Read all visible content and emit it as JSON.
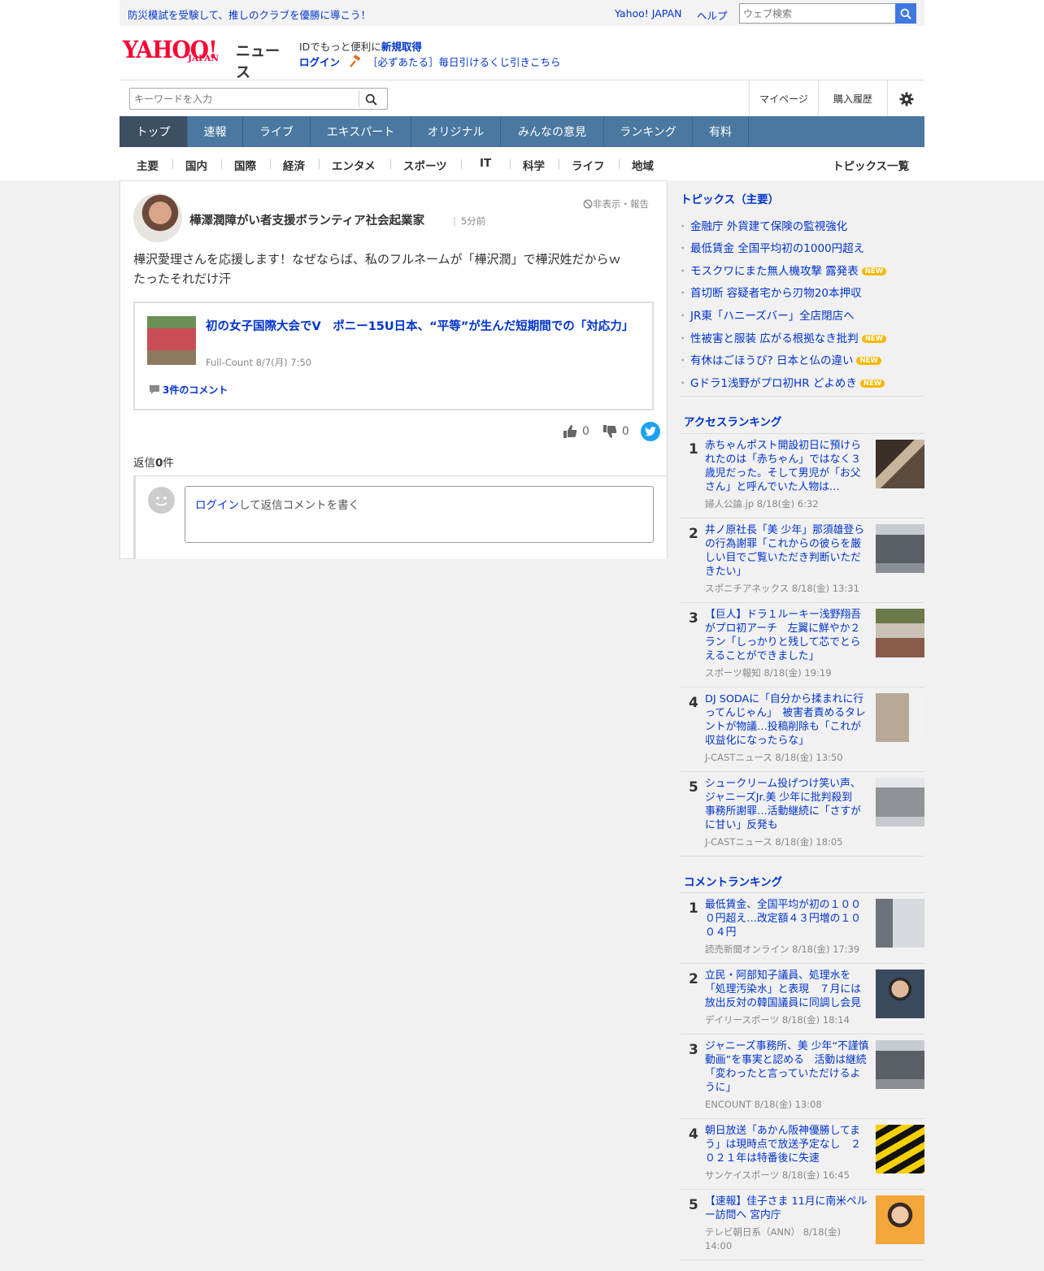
{
  "promo": {
    "text": "防災模試を受験して、推しのクラブを優勝に導こう！"
  },
  "header": {
    "yahoo_japan_link": "Yahoo! JAPAN",
    "help_link": "ヘルプ",
    "web_search_placeholder": "ウェブ検索",
    "logo_yahoo": "YAHOO!",
    "logo_japan": "JAPAN",
    "logo_news": "ニュース",
    "id_prefix": "IDでもっと便利に",
    "id_signup": "新規取得",
    "login": "ログイン",
    "lottery_text": "［必ずあたる］毎日引けるくじ引きこちら",
    "keyword_placeholder": "キーワードを入力",
    "mypage": "マイページ",
    "purchase_history": "購入履歴",
    "settings_icon": "gear-icon"
  },
  "nav": {
    "items": [
      "トップ",
      "速報",
      "ライブ",
      "エキスパート",
      "オリジナル",
      "みんなの意見",
      "ランキング",
      "有料"
    ],
    "active": "トップ",
    "color": "#4a78a0",
    "active_color": "#3c4f63"
  },
  "subnav": {
    "items": [
      "主要",
      "国内",
      "国際",
      "経済",
      "エンタメ",
      "スポーツ",
      "IT",
      "科学",
      "ライフ",
      "地域"
    ],
    "topics_list": "トピックス一覧"
  },
  "comment": {
    "author": "樺澤潤障がい者支援ボランティア社会起業家",
    "time": "5分前",
    "hide_report": "非表示・報告",
    "body_line1": "樺沢愛理さんを応援します！なぜならば、私のフルネームが「樺沢潤」で樺沢姓だからｗ",
    "body_line2": "たったそれだけ汗",
    "article_title": "初の女子国際大会でV　ポニー15U日本、“平等”が生んだ短期間での「対応力」",
    "article_meta": "Full-Count 8/7(月) 7:50",
    "article_comments": "3件のコメント",
    "likes": "0",
    "dislikes": "0",
    "reply_label": "返信",
    "reply_count": "0",
    "reply_suffix": "件",
    "reply_login": "ログイン",
    "reply_placeholder": "して返信コメントを書く"
  },
  "topics": {
    "title": "トピックス（主要）",
    "items": [
      {
        "text": "金融庁 外貨建て保険の監視強化",
        "new": ""
      },
      {
        "text": "最低賃金 全国平均初の1000円超え",
        "new": ""
      },
      {
        "text": "モスクワにまた無人機攻撃 露発表",
        "new": "NEW"
      },
      {
        "text": "首切断 容疑者宅から刃物20本押収",
        "new": ""
      },
      {
        "text": "JR東「ハニーズバー」全店閉店へ",
        "new": ""
      },
      {
        "text": "性被害と服装 広がる根拠なき批判",
        "new": "NEW"
      },
      {
        "text": "有休はごほうび? 日本と仏の違い",
        "new": "NEW"
      },
      {
        "text": "Gドラ1浅野がプロ初HR どよめき",
        "new": "NEW"
      }
    ]
  },
  "access_ranking": {
    "title": "アクセスランキング",
    "items": [
      {
        "rank": "1",
        "title": "赤ちゃんポスト開設初日に預けられたのは「赤ちゃん」ではなく３歳児だった。そして男児が「お父さん」と呼んでいた人物は…",
        "meta": "婦人公論.jp 8/18(金) 6:32"
      },
      {
        "rank": "2",
        "title": "井ノ原社長「美 少年」那須雄登らの行為謝罪「これからの彼らを厳しい目でご覧いただき判断いただきたい」",
        "meta": "スポニチアネックス 8/18(金) 13:31"
      },
      {
        "rank": "3",
        "title": "【巨人】ドラ１ルーキー浅野翔吾がプロ初アーチ　左翼に鮮やか２ラン「しっかりと残して芯でとらえることができました」",
        "meta": "スポーツ報知 8/18(金) 19:19"
      },
      {
        "rank": "4",
        "title": "DJ SODAに「自分から揉まれに行ってんじゃん」　被害者責めるタレントが物議…投稿削除も「これが収益化になったらな」",
        "meta": "J-CASTニュース 8/18(金) 13:50"
      },
      {
        "rank": "5",
        "title": "シュークリーム投げつけ笑い声、ジャニーズJr.美 少年に批判殺到　事務所謝罪…活動継続に「さすがに甘い」反発も",
        "meta": "J-CASTニュース 8/18(金) 18:05"
      }
    ]
  },
  "comment_ranking": {
    "title": "コメントランキング",
    "items": [
      {
        "rank": "1",
        "title": "最低賃金、全国平均が初の１０００円超え…改定額４３円増の１００４円",
        "meta": "読売新聞オンライン 8/18(金) 17:39"
      },
      {
        "rank": "2",
        "title": "立民・阿部知子議員、処理水を「処理汚染水」と表現　７月には放出反対の韓国議員に同調し会見",
        "meta": "デイリースポーツ 8/18(金) 18:14"
      },
      {
        "rank": "3",
        "title": "ジャニーズ事務所、美 少年“不謹慎動画”を事実と認める　活動は継続「変わったと言っていただけるように」",
        "meta": "ENCOUNT 8/18(金) 13:08"
      },
      {
        "rank": "4",
        "title": "朝日放送「あかん阪神優勝してまう」は現時点で放送予定なし　２０２１年は特番後に失速",
        "meta": "サンケイスポーツ 8/18(金) 16:45"
      },
      {
        "rank": "5",
        "title": "【速報】佳子さま 11月に南米ペルー訪問へ 宮内庁",
        "meta": "テレビ朝日系（ANN） 8/18(金) 14:00"
      }
    ]
  }
}
